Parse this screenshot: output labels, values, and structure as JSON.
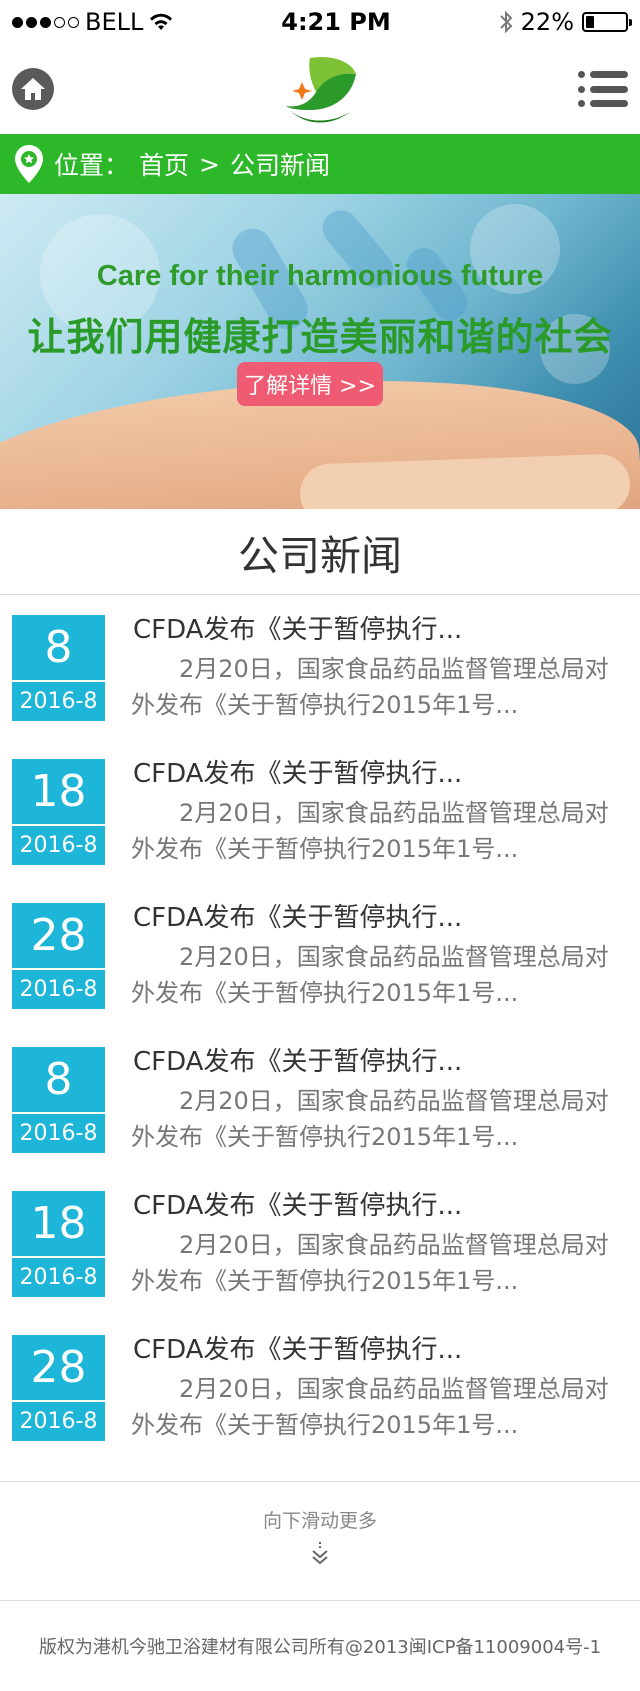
{
  "status_bar": {
    "carrier": "BELL",
    "time": "4:21 PM",
    "battery": "22%"
  },
  "breadcrumb": {
    "label": "位置：",
    "home": "首页",
    "separator": ">",
    "current": "公司新闻"
  },
  "banner": {
    "english_text": "Care for their harmonious future",
    "chinese_text": "让我们用健康打造美丽和谐的社会",
    "button_label": "了解详情 >>"
  },
  "section": {
    "title": "公司新闻"
  },
  "news": [
    {
      "day": "8",
      "ym": "2016-8",
      "title": "CFDA发布《关于暂停执行...",
      "desc": "2月20日，国家食品药品监督管理总局对外发布《关于暂停执行2015年1号..."
    },
    {
      "day": "18",
      "ym": "2016-8",
      "title": "CFDA发布《关于暂停执行...",
      "desc": "2月20日，国家食品药品监督管理总局对外发布《关于暂停执行2015年1号..."
    },
    {
      "day": "28",
      "ym": "2016-8",
      "title": "CFDA发布《关于暂停执行...",
      "desc": "2月20日，国家食品药品监督管理总局对外发布《关于暂停执行2015年1号..."
    },
    {
      "day": "8",
      "ym": "2016-8",
      "title": "CFDA发布《关于暂停执行...",
      "desc": "2月20日，国家食品药品监督管理总局对外发布《关于暂停执行2015年1号..."
    },
    {
      "day": "18",
      "ym": "2016-8",
      "title": "CFDA发布《关于暂停执行...",
      "desc": "2月20日，国家食品药品监督管理总局对外发布《关于暂停执行2015年1号..."
    },
    {
      "day": "28",
      "ym": "2016-8",
      "title": "CFDA发布《关于暂停执行...",
      "desc": "2月20日，国家食品药品监督管理总局对外发布《关于暂停执行2015年1号..."
    }
  ],
  "more": {
    "label": "向下滑动更多"
  },
  "footer": {
    "copyright": "版权为港机今驰卫浴建材有限公司所有@2013闽ICP备11009004号-1"
  },
  "colors": {
    "brand_green": "#2db82a",
    "date_blue": "#1eb6d8",
    "button_pink": "#ee5b72"
  }
}
